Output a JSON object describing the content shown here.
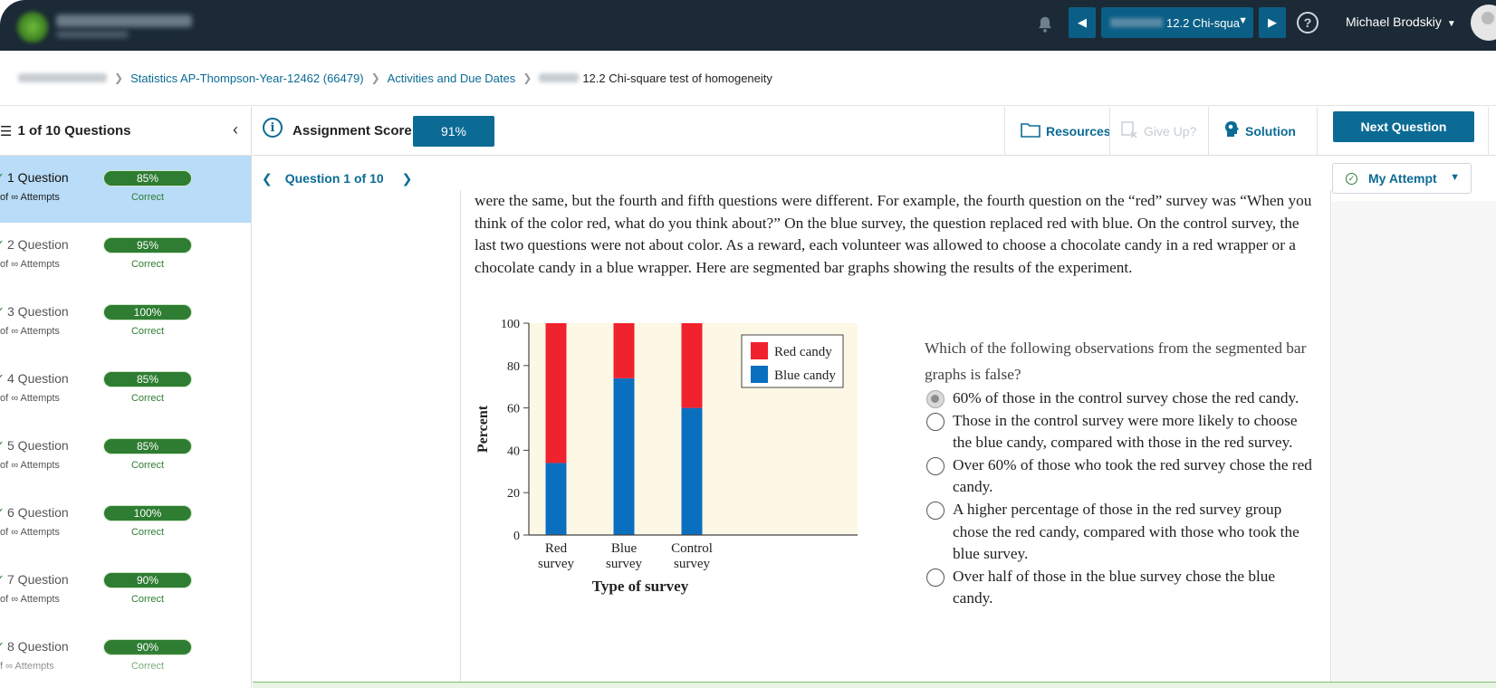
{
  "topbar": {
    "assignment_select": "12.2 Chi-squa",
    "user_name": "Michael Brodskiy"
  },
  "breadcrumb": {
    "course": "Statistics AP-Thompson-Year-12462 (66479)",
    "section": "Activities and Due Dates",
    "current": "12.2 Chi-square test of homogeneity"
  },
  "sidebar": {
    "title": "1 of 10 Questions",
    "items": [
      {
        "label": "1 Question",
        "sub": "of ∞ Attempts",
        "score": "85%",
        "status": "Correct"
      },
      {
        "label": "2 Question",
        "sub": "of ∞ Attempts",
        "score": "95%",
        "status": "Correct"
      },
      {
        "label": "3 Question",
        "sub": "of ∞ Attempts",
        "score": "100%",
        "status": "Correct"
      },
      {
        "label": "4 Question",
        "sub": "of ∞ Attempts",
        "score": "85%",
        "status": "Correct"
      },
      {
        "label": "5 Question",
        "sub": "of ∞ Attempts",
        "score": "85%",
        "status": "Correct"
      },
      {
        "label": "6 Question",
        "sub": "of ∞ Attempts",
        "score": "100%",
        "status": "Correct"
      },
      {
        "label": "7 Question",
        "sub": "of ∞ Attempts",
        "score": "90%",
        "status": "Correct"
      },
      {
        "label": "8 Question",
        "sub": "f ∞ Attempts",
        "score": "90%",
        "status": "Correct"
      }
    ]
  },
  "scorebar": {
    "label": "Assignment Score:",
    "value": "91%",
    "resources": "Resources",
    "give_up": "Give Up?",
    "solution": "Solution",
    "next": "Next Question"
  },
  "qnav": {
    "label": "Question 1 of 10",
    "attempt": "My Attempt"
  },
  "question": {
    "passage": "were the same, but the fourth and fifth questions were different. For example, the fourth question on the “red” survey was “When you think of the color red, what do you think about?” On the blue survey, the question replaced red with blue. On the control survey, the last two questions were not about color. As a reward, each volunteer was allowed to choose a chocolate candy in a red wrapper or a chocolate candy in a blue wrapper. Here are segmented bar graphs showing the results of the experiment.",
    "prompt": "Which of the following observations from the segmented bar graphs is false?",
    "choices": [
      "60% of those in the control survey chose the red candy.",
      "Those in the control survey were more likely to choose the blue candy, compared with those in the red survey.",
      "Over 60% of those who took the red survey chose the red candy.",
      "A higher percentage of those in the red survey group chose the red candy, compared with those who took the blue survey.",
      "Over half of those in the blue survey chose the blue candy."
    ],
    "selected_index": 0
  },
  "chart_data": {
    "type": "bar",
    "stacked": true,
    "categories": [
      "Red\nsurvey",
      "Blue\nsurvey",
      "Control\nsurvey"
    ],
    "series": [
      {
        "name": "Blue candy",
        "color": "#0b6fc0",
        "values": [
          34,
          74,
          60
        ]
      },
      {
        "name": "Red candy",
        "color": "#f0222e",
        "values": [
          66,
          26,
          40
        ]
      }
    ],
    "xlabel": "Type of survey",
    "ylabel": "Percent",
    "ylim": [
      0,
      100
    ],
    "yticks": [
      0,
      20,
      40,
      60,
      80,
      100
    ],
    "legend": "top-right",
    "plot_background": "#fdf8e6"
  },
  "colors": {
    "accent": "#0b6b95",
    "correct": "#2e7d32",
    "active_row": "#b9dcf8",
    "topbar": "#1b2a36"
  }
}
